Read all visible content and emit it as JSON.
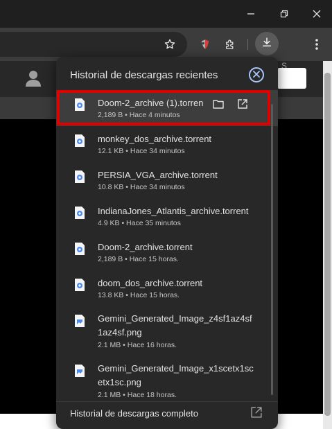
{
  "panel": {
    "title": "Historial de descargas recientes",
    "footer_label": "Historial de descargas completo"
  },
  "page": {
    "partial_text": "S"
  },
  "downloads": [
    {
      "name": "Doom-2_archive (1).torrent",
      "meta": "2,189 B • Hace 4 minutos",
      "type": "torrent"
    },
    {
      "name": "monkey_dos_archive.torrent",
      "meta": "12.1 KB • Hace 34 minutos",
      "type": "torrent"
    },
    {
      "name": "PERSIA_VGA_archive.torrent",
      "meta": "10.8 KB • Hace 34 minutos",
      "type": "torrent"
    },
    {
      "name": "IndianaJones_Atlantis_archive.torrent",
      "meta": "4.9 KB • Hace 35 minutos",
      "type": "torrent"
    },
    {
      "name": "Doom-2_archive.torrent",
      "meta": "2,189 B • Hace 15 horas.",
      "type": "torrent"
    },
    {
      "name": "doom_dos_archive.torrent",
      "meta": "13.8 KB • Hace 15 horas.",
      "type": "torrent"
    },
    {
      "name": "Gemini_Generated_Image_z4sf1az4sf1az4sf.png",
      "meta": "2.1 MB • Hace 16 horas.",
      "type": "image"
    },
    {
      "name": "Gemini_Generated_Image_x1scetx1scetx1sc.png",
      "meta": "2.1 MB • Hace 18 horas.",
      "type": "image"
    }
  ],
  "colors": {
    "accent": "#a8c7fa",
    "highlight": "#e00000",
    "panel_bg": "#282828"
  },
  "icons": [
    "minimize-icon",
    "restore-icon",
    "close-window-icon",
    "star-icon",
    "extension-icon",
    "puzzle-icon",
    "download-icon",
    "kebab-menu-icon",
    "profile-icon",
    "folder-icon",
    "open-external-icon"
  ]
}
